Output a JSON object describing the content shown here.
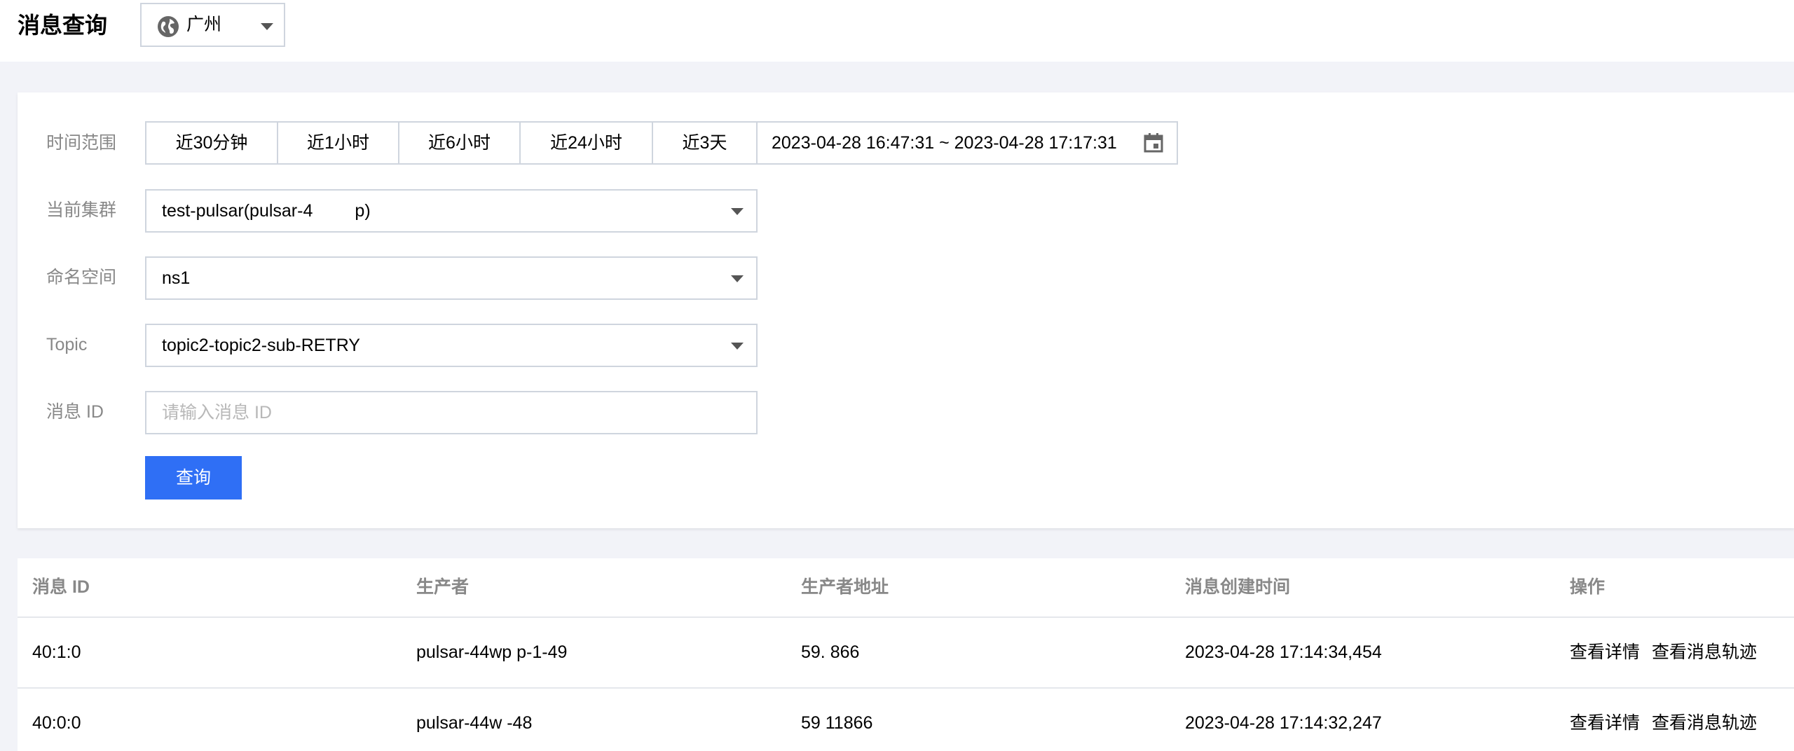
{
  "header": {
    "title": "消息查询",
    "region": {
      "icon": "globe-icon",
      "label": "广州"
    }
  },
  "form": {
    "time_range": {
      "label": "时间范围",
      "quick_options": [
        "近30分钟",
        "近1小时",
        "近6小时",
        "近24小时",
        "近3天"
      ],
      "range_value": "2023-04-28 16:47:31 ~ 2023-04-28 17:17:31",
      "calendar_icon": "calendar-icon"
    },
    "cluster": {
      "label": "当前集群",
      "value": "test-pulsar(pulsar-4            p)"
    },
    "namespace": {
      "label": "命名空间",
      "value": "ns1"
    },
    "topic": {
      "label": "Topic",
      "value": "topic2-topic2-sub-RETRY"
    },
    "message_id": {
      "label": "消息 ID",
      "placeholder": "请输入消息 ID",
      "value": ""
    },
    "query_button": "查询"
  },
  "table": {
    "columns": [
      "消息 ID",
      "生产者",
      "生产者地址",
      "消息创建时间",
      "操作"
    ],
    "rows": [
      {
        "message_id": "40:1:0",
        "producer": "pulsar-44wp            p-1-49",
        "producer_addr": "59.             866",
        "created_at": "2023-04-28 17:14:34,454",
        "actions": [
          "查看详情",
          "查看消息轨迹"
        ]
      },
      {
        "message_id": "40:0:0",
        "producer": "pulsar-44w             -48",
        "producer_addr": "59            11866",
        "created_at": "2023-04-28 17:14:32,247",
        "actions": [
          "查看详情",
          "查看消息轨迹"
        ]
      }
    ]
  },
  "colors": {
    "primary": "#2f6ff5",
    "border": "#cfd5de",
    "label_gray": "#888888",
    "page_bg": "#f2f3f8"
  }
}
